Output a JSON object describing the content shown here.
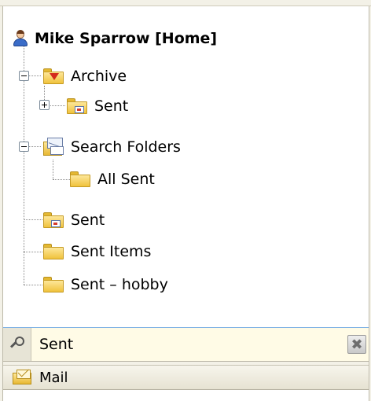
{
  "tree": {
    "account": {
      "label": "Mike Sparrow [Home]",
      "icon": "user-icon"
    },
    "archive": {
      "label": "Archive",
      "icon": "archive-folder-icon",
      "children": [
        {
          "label": "Sent",
          "icon": "sent-folder-icon",
          "collapsed": true
        }
      ]
    },
    "search_folders": {
      "label": "Search Folders",
      "icon": "search-folders-icon",
      "children": [
        {
          "label": "All Sent",
          "icon": "folder-icon"
        }
      ]
    },
    "folders": [
      {
        "label": "Sent",
        "icon": "sent-folder-icon"
      },
      {
        "label": "Sent Items",
        "icon": "folder-icon"
      },
      {
        "label": "Sent – hobby",
        "icon": "folder-icon"
      }
    ]
  },
  "search": {
    "value": "Sent",
    "icon": "search-icon",
    "clear_icon": "close-icon"
  },
  "nav": {
    "mail_label": "Mail",
    "icon": "mail-icon"
  },
  "colors": {
    "search_bar_bg": "#fffbe6",
    "accent_border": "#7fb2e5",
    "folder_yellow": "#f0c23c"
  }
}
